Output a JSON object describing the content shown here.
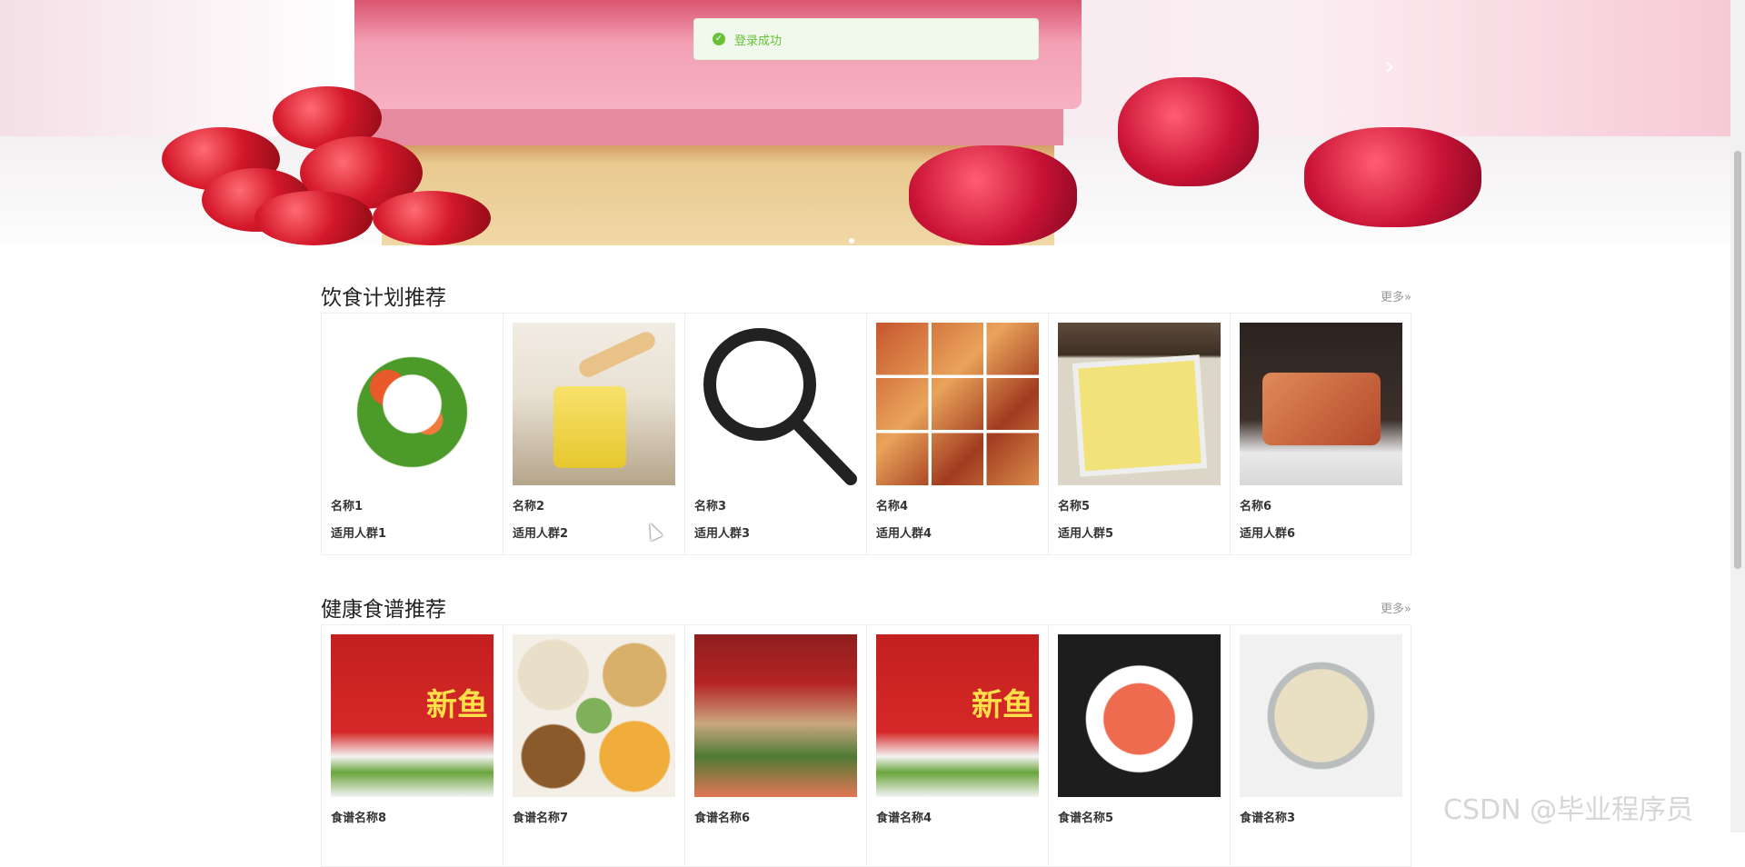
{
  "toast": {
    "message": "登录成功",
    "icon": "check-circle-icon",
    "color": "#67c23a"
  },
  "banner": {
    "next_icon": "chevron-right-icon",
    "dots": 1,
    "active_dot": 1
  },
  "diet_plans": {
    "title": "饮食计划推荐",
    "more": "更多»",
    "items": [
      {
        "name": "名称1",
        "group": "适用人群1"
      },
      {
        "name": "名称2",
        "group": "适用人群2"
      },
      {
        "name": "名称3",
        "group": "适用人群3"
      },
      {
        "name": "名称4",
        "group": "适用人群4"
      },
      {
        "name": "名称5",
        "group": "适用人群5"
      },
      {
        "name": "名称6",
        "group": "适用人群6"
      }
    ]
  },
  "recipes": {
    "title": "健康食谱推荐",
    "more": "更多»",
    "items": [
      {
        "name": "食谱名称8"
      },
      {
        "name": "食谱名称7"
      },
      {
        "name": "食谱名称6"
      },
      {
        "name": "食谱名称4"
      },
      {
        "name": "食谱名称5"
      },
      {
        "name": "食谱名称3"
      }
    ]
  },
  "watermark": "CSDN @毕业程序员"
}
